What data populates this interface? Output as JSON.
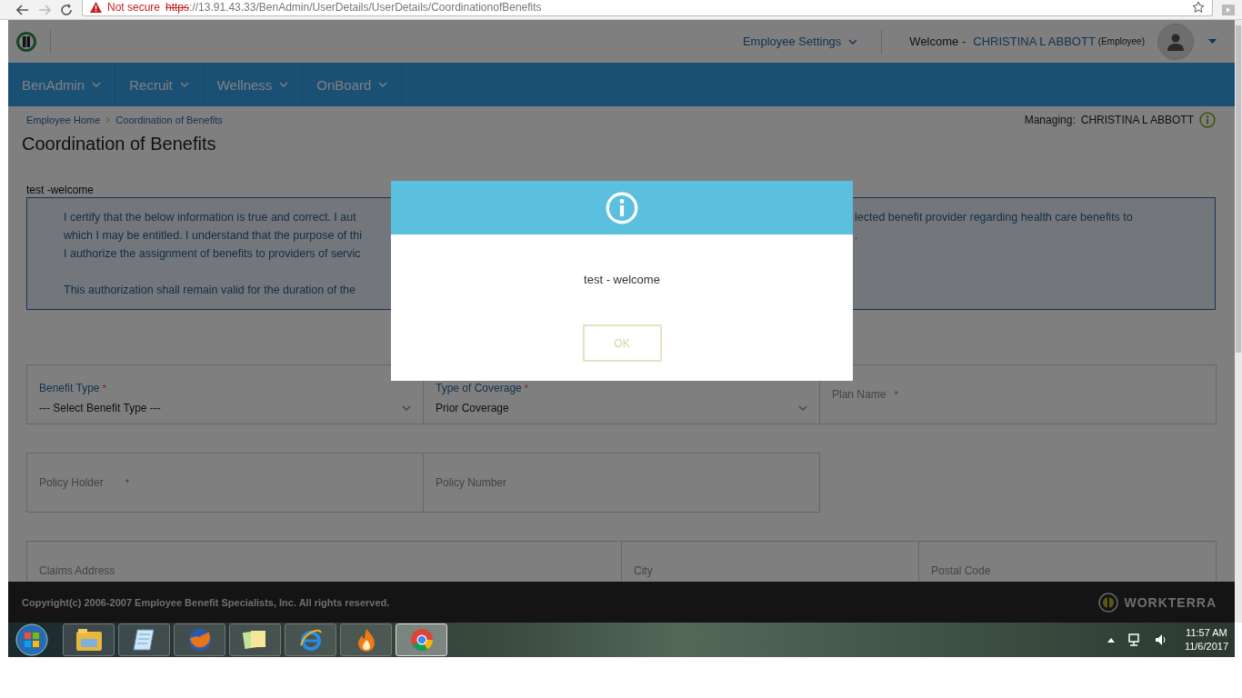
{
  "browser": {
    "security": "Not secure",
    "url": {
      "scheme": "https",
      "rest": "://13.91.43.33/BenAdmin/UserDetails/UserDetails/CoordinationofBenefits"
    }
  },
  "header": {
    "settings_menu": "Employee Settings",
    "welcome": "Welcome -",
    "user_name": "CHRISTINA L ABBOTT",
    "user_role": "(Employee)"
  },
  "nav": [
    {
      "label": "BenAdmin"
    },
    {
      "label": "Recruit"
    },
    {
      "label": "Wellness"
    },
    {
      "label": "OnBoard"
    }
  ],
  "breadcrumb": [
    {
      "label": "Employee Home"
    },
    {
      "label": "Coordination of Benefits"
    }
  ],
  "managing": {
    "label": "Managing:",
    "name": "CHRISTINA L ABBOTT"
  },
  "page_title": "Coordination of Benefits",
  "notice": {
    "title": "test -welcome",
    "lines": [
      {
        "kind": "text",
        "left": "I certify that the below information is true and correct. I aut",
        "right": "lected benefit provider regarding health care benefits to"
      },
      {
        "kind": "text",
        "left": "which I may be entitled. I understand that the purpose of thi",
        "right": "."
      },
      {
        "kind": "text",
        "left": "I authorize the assignment of benefits to providers of servic"
      },
      {
        "kind": "blank"
      },
      {
        "kind": "text",
        "left": "This authorization shall remain valid for the duration of the"
      }
    ]
  },
  "form_rows": [
    {
      "kind": "thirds",
      "fields": [
        {
          "kind": "select",
          "label": "Benefit Type",
          "mark": "*",
          "value": "--- Select Benefit Type ---"
        },
        {
          "kind": "select",
          "label": "Type of Coverage",
          "mark": "*",
          "value": "Prior Coverage"
        },
        {
          "kind": "input",
          "placeholder": "Plan Name",
          "mark": "*"
        }
      ]
    },
    {
      "kind": "thirds",
      "fields": [
        {
          "kind": "input",
          "placeholder": "Policy Holder",
          "mark": "*"
        },
        {
          "kind": "input",
          "placeholder": "Policy Number"
        }
      ]
    },
    {
      "kind": "address",
      "fields": [
        {
          "kind": "input",
          "placeholder": "Claims Address"
        },
        {
          "kind": "input",
          "placeholder": "City"
        },
        {
          "kind": "input",
          "placeholder": "Postal Code"
        }
      ]
    }
  ],
  "footer": {
    "copyright": "Copyright(c) 2006-2007 Employee Benefit Specialists, Inc. All rights reserved.",
    "brand": "WORKTERRA"
  },
  "dialog": {
    "message": "test - welcome",
    "button": "OK"
  },
  "taskbar": {
    "apps": [
      {
        "selected": false
      },
      {
        "selected": false
      },
      {
        "selected": false
      },
      {
        "selected": false
      },
      {
        "selected": false
      },
      {
        "selected": false
      },
      {
        "selected": true
      }
    ],
    "time": "11:57 AM",
    "date": "11/6/2017"
  }
}
